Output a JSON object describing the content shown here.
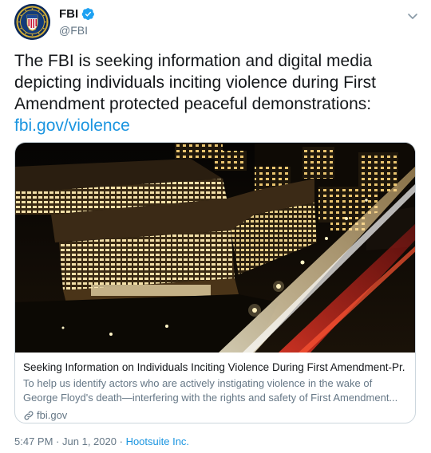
{
  "account": {
    "display_name": "FBI",
    "handle": "@FBI",
    "verified": true,
    "avatar_icon": "fbi-seal-icon"
  },
  "tweet": {
    "text": "The FBI is seeking information and digital media depicting individuals inciting violence during First Amendment protected peaceful demonstrations:",
    "link_text": "fbi.gov/violence"
  },
  "card": {
    "image_icon": "fbi-headquarters-night-photo",
    "title": "Seeking Information on Individuals Inciting Violence During First Amendment-Pr...",
    "description": "To help us identify actors who are actively instigating violence in the wake of George Floyd's death—interfering with the rights and safety of First Amendment...",
    "domain": "fbi.gov"
  },
  "meta": {
    "time": "5:47 PM",
    "date": "Jun 1, 2020",
    "separator": "·",
    "source": "Hootsuite Inc."
  },
  "colors": {
    "link": "#1b95e0",
    "muted": "#657786",
    "text": "#14171a",
    "border": "#ccd6dd",
    "verified": "#1da1f2"
  }
}
